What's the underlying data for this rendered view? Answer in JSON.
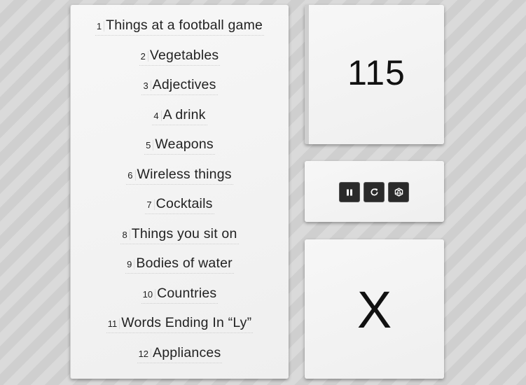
{
  "categories": [
    {
      "num": "1",
      "label": "Things at a football game"
    },
    {
      "num": "2",
      "label": "Vegetables"
    },
    {
      "num": "3",
      "label": "Adjectives"
    },
    {
      "num": "4",
      "label": "A drink"
    },
    {
      "num": "5",
      "label": "Weapons"
    },
    {
      "num": "6",
      "label": "Wireless things"
    },
    {
      "num": "7",
      "label": "Cocktails"
    },
    {
      "num": "8",
      "label": "Things you sit on"
    },
    {
      "num": "9",
      "label": "Bodies of water"
    },
    {
      "num": "10",
      "label": "Countries"
    },
    {
      "num": "11",
      "label": "Words Ending In “Ly”"
    },
    {
      "num": "12",
      "label": "Appliances"
    }
  ],
  "timer": {
    "value": "115"
  },
  "letter": {
    "value": "X"
  },
  "controls": {
    "pause_icon": "pause-icon",
    "restart_icon": "restart-icon",
    "dice_icon": "dice-icon"
  }
}
